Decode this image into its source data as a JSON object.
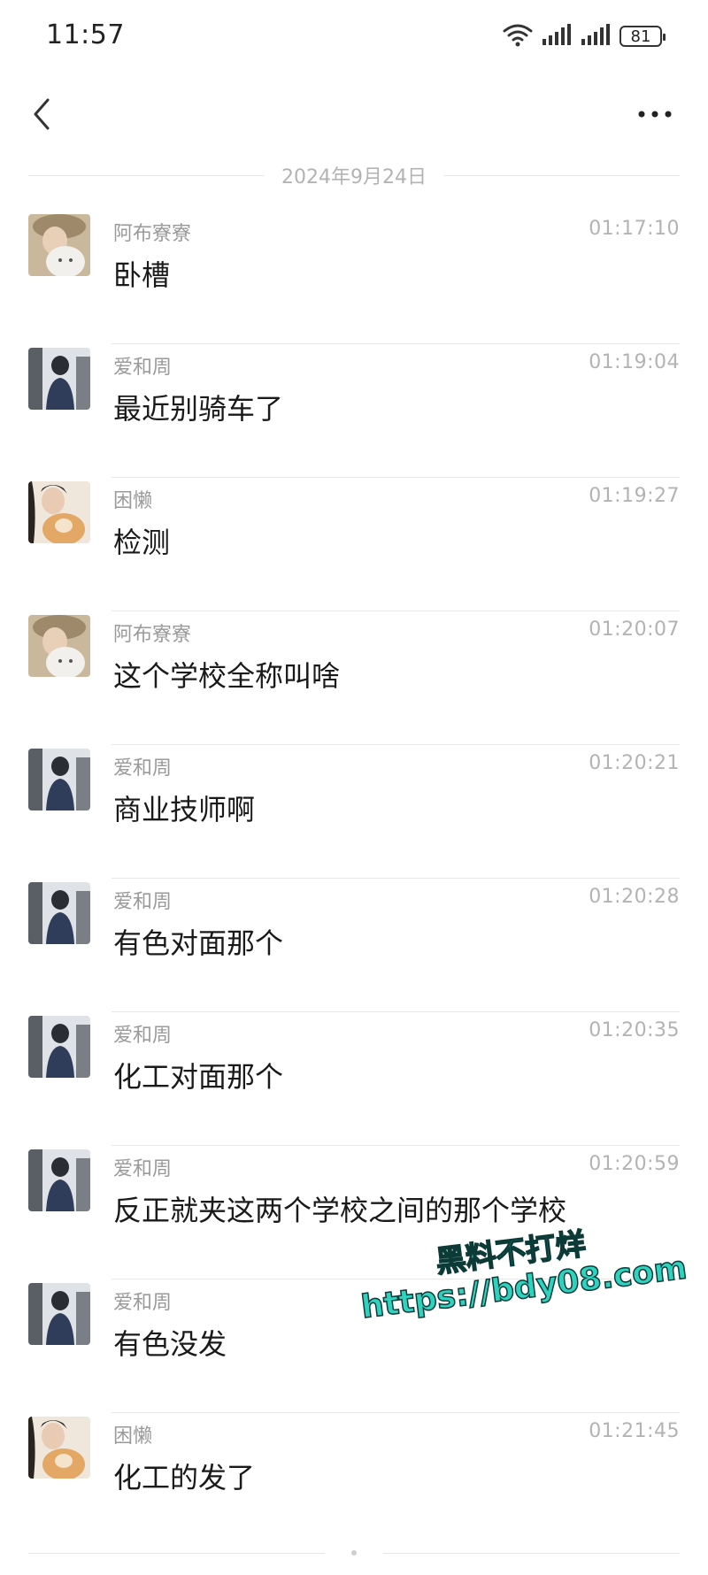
{
  "status_bar": {
    "time": "11:57",
    "battery": "81"
  },
  "date_label": "2024年9月24日",
  "messages": [
    {
      "name": "阿布寮寮",
      "time": "01:17:10",
      "text": "卧槽",
      "avatar": "avatar-abu"
    },
    {
      "name": "爱和周",
      "time": "01:19:04",
      "text": "最近别骑车了",
      "avatar": "avatar-aihezhou"
    },
    {
      "name": "困懒",
      "time": "01:19:27",
      "text": "检测",
      "avatar": "avatar-kunlan"
    },
    {
      "name": "阿布寮寮",
      "time": "01:20:07",
      "text": "这个学校全称叫啥",
      "avatar": "avatar-abu"
    },
    {
      "name": "爱和周",
      "time": "01:20:21",
      "text": "商业技师啊",
      "avatar": "avatar-aihezhou"
    },
    {
      "name": "爱和周",
      "time": "01:20:28",
      "text": "有色对面那个",
      "avatar": "avatar-aihezhou"
    },
    {
      "name": "爱和周",
      "time": "01:20:35",
      "text": "化工对面那个",
      "avatar": "avatar-aihezhou"
    },
    {
      "name": "爱和周",
      "time": "01:20:59",
      "text": "反正就夹这两个学校之间的那个学校",
      "avatar": "avatar-aihezhou"
    },
    {
      "name": "爱和周",
      "time": "",
      "text": "有色没发",
      "avatar": "avatar-aihezhou"
    },
    {
      "name": "困懒",
      "time": "01:21:45",
      "text": "化工的发了",
      "avatar": "avatar-kunlan"
    }
  ],
  "watermark": {
    "line1": "黑料不打烊",
    "line2": "https://bdy08.com"
  },
  "colors": {
    "text": "#1a1a1a",
    "meta": "#9a9a9a",
    "divider": "#e8e8e8",
    "watermark": "#2ed3c0"
  }
}
